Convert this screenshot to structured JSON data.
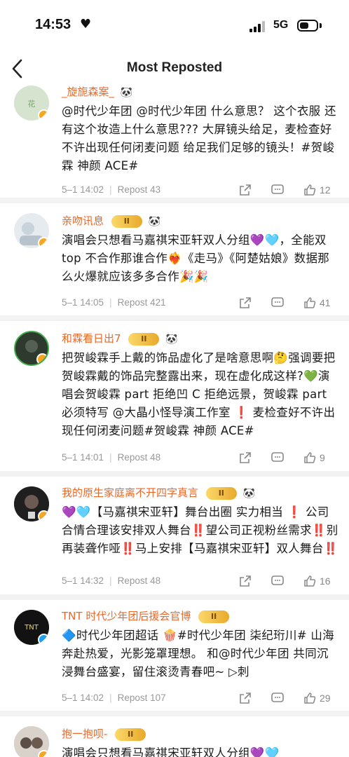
{
  "status": {
    "time": "14:53",
    "network": "5G"
  },
  "header": {
    "title": "Most Reposted"
  },
  "posts": [
    {
      "user": "_旋旎森案_",
      "content": [
        "@时代少年团 @时代少年团 什么意思？ 这个衣服 还有这个妆造上什么意思??? 大屏镜头给足，麦检查好不许出现任何闭麦问题 给足我们足够的镜头！#贺峻霖 神颜 ACE#"
      ],
      "time": "5–1 14:02",
      "repost": "Repost 43",
      "likes": "12"
    },
    {
      "user": "亲吻讯息",
      "content": [
        "演唱会只想看马嘉祺宋亚轩双人分组💜🩵，全能双 top 不合作那谁合作❤️‍🔥《走马》《阿楚姑娘》数据那么火爆就应该多多合作🎉🎉"
      ],
      "time": "5–1 14:05",
      "repost": "Repost 421",
      "likes": "41"
    },
    {
      "user": "和霖看日出7",
      "content": [
        "把贺峻霖手上戴的饰品虚化了是啥意思啊🤔强调要把贺峻霖戴的饰品完整露出来，现在虚化成这样?💚演唱会贺峻霖 part 拒绝凹 C 拒绝远景，贺峻霖 part 必须特写 @大晶小怪导演工作室 ❗ 麦检查好不许出现任何闭麦问题#贺峻霖 神颜 ACE#"
      ],
      "time": "5–1 14:01",
      "repost": "Repost 48",
      "likes": "9"
    },
    {
      "user": "我的原生家庭离不开四字真言",
      "content": [
        "💜🩵【马嘉祺宋亚轩】舞台出圈 实力相当 ❗ 公司合情合理该安排双人舞台‼️望公司正视粉丝需求‼️别再装聋作哑‼️马上安排【马嘉祺宋亚轩】双人舞台‼️"
      ],
      "time": "5–1 14:32",
      "repost": "Repost 48",
      "likes": "16"
    },
    {
      "user": "TNT 时代少年团后援会官博",
      "content": [
        "🔷时代少年团超话 🍿#时代少年团 柒纪珩川# 山海奔赴热爱，光影笼罩理想。 和@时代少年团 共同沉浸舞台盛宴，留住滚烫青春吧~ ▷刺"
      ],
      "time": "5–1 14:02",
      "repost": "Repost 107",
      "likes": "29"
    },
    {
      "user": "抱一抱呗-",
      "content": [
        "演唱会只想看马嘉祺宋亚轩双人分组💜🩵"
      ],
      "time": "",
      "repost": "",
      "likes": ""
    }
  ],
  "labels": {
    "crown": "II"
  }
}
